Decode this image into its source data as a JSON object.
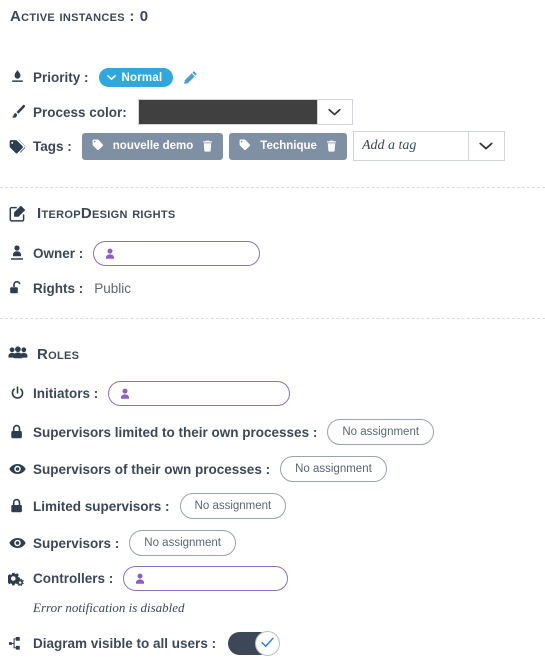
{
  "header": {
    "title": "Active instances :",
    "count": "0"
  },
  "properties": {
    "priority": {
      "label": "Priority :",
      "value": "Normal",
      "badge_color": "#2fa8e0",
      "icon": "priority-icon",
      "edit_icon": "pencil-icon",
      "chevron_icon": "chevron-down-icon"
    },
    "process_color": {
      "label": "Process color:",
      "value": "#404040",
      "icon": "brush-icon",
      "caret_icon": "chevron-down-icon"
    },
    "tags": {
      "label": "Tags :",
      "icon": "tags-icon",
      "items": [
        {
          "label": "nouvelle demo",
          "icon": "tag-icon",
          "delete_icon": "trash-icon"
        },
        {
          "label": "Technique",
          "icon": "tag-icon",
          "delete_icon": "trash-icon"
        }
      ],
      "add_placeholder": "Add a tag",
      "add_value": "",
      "chip_color": "#7f8fa4",
      "caret_icon": "chevron-down-icon"
    }
  },
  "rights_section": {
    "title": "IteropDesign rights",
    "icon": "edit-square-icon",
    "owner": {
      "label": "Owner :",
      "icon": "owner-icon",
      "value": "",
      "person_icon": "person-icon",
      "accent": "#8e6fc4"
    },
    "rights": {
      "label": "Rights :",
      "icon": "unlock-icon",
      "value": "Public"
    }
  },
  "roles_section": {
    "title": "Roles",
    "icon": "users-icon",
    "rows": [
      {
        "label": "Initiators :",
        "icon": "power-icon",
        "type": "person",
        "value": "",
        "person_icon": "person-icon"
      },
      {
        "label": "Supervisors limited to their own processes :",
        "icon": "lock-icon",
        "type": "none",
        "value": "No assignment"
      },
      {
        "label": "Supervisors of their own processes :",
        "icon": "eye-icon",
        "type": "none",
        "value": "No assignment"
      },
      {
        "label": "Limited supervisors :",
        "icon": "lock-icon",
        "type": "none",
        "value": "No assignment"
      },
      {
        "label": "Supervisors :",
        "icon": "eye-icon",
        "type": "none",
        "value": "No assignment"
      },
      {
        "label": "Controllers :",
        "icon": "cogs-icon",
        "type": "person",
        "value": "",
        "person_icon": "person-icon"
      }
    ],
    "controllers_hint": "Error notification is disabled",
    "visibility": {
      "label": "Diagram visible to all users :",
      "icon": "diagram-icon",
      "enabled": true,
      "track_color": "#3c4858",
      "check_icon": "check-icon"
    }
  }
}
